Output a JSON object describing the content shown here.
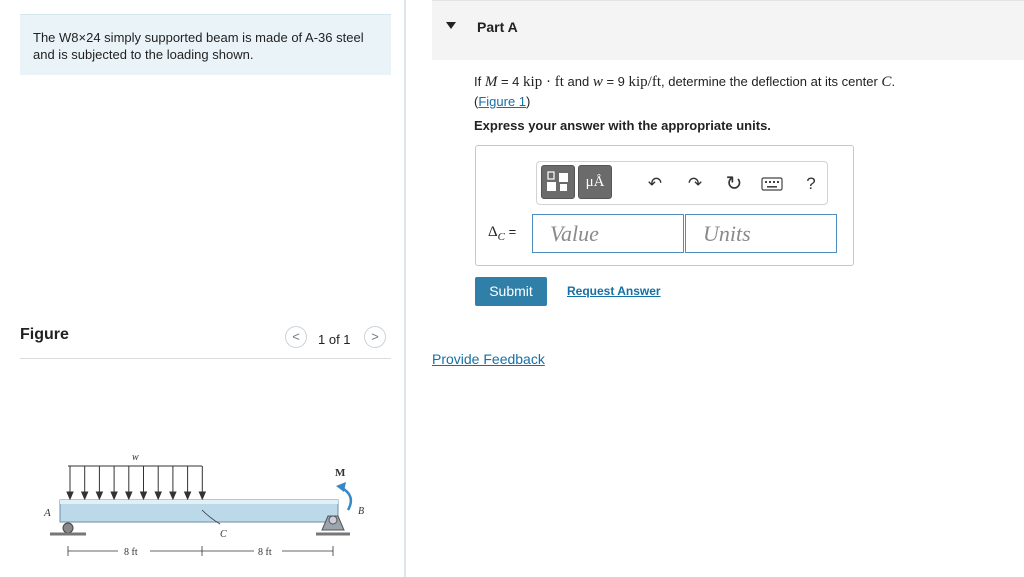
{
  "problem": {
    "text": "The W8×24 simply supported beam is made of A-36 steel and is subjected to the loading shown."
  },
  "figure_panel": {
    "title": "Figure",
    "pager": "1 of 1",
    "prev_glyph": "<",
    "next_glyph": ">",
    "labels": {
      "w": "w",
      "M": "M",
      "A": "A",
      "B": "B",
      "C": "C",
      "dim1": "8 ft",
      "dim2": "8 ft"
    }
  },
  "part": {
    "title": "Part A",
    "q_if": "If",
    "q_M": "M",
    "q_eq1": " = 4",
    "q_unit1": "kip · ft",
    "q_and": "and",
    "q_w": "w",
    "q_eq2": " = 9",
    "q_unit2": "kip/ft",
    "q_rest": ", determine the deflection at its center",
    "q_C": "C",
    "q_end": ".",
    "fig_link_open": "(",
    "fig_link": "Figure 1",
    "fig_link_close": ")",
    "express": "Express your answer with the appropriate units."
  },
  "answer": {
    "delta_label": "Δ",
    "delta_sub": "C",
    "delta_eq": " =",
    "value_placeholder": "Value",
    "units_placeholder": "Units",
    "toolbar": {
      "templates_label": "templates",
      "units_label": "μÅ",
      "undo_icon": "↶",
      "redo_icon": "↷",
      "reset_icon": "↻",
      "help_label": "?"
    }
  },
  "actions": {
    "submit": "Submit",
    "request_answer": "Request Answer",
    "provide_feedback": "Provide Feedback"
  },
  "colors": {
    "accent": "#2f7fa8",
    "link": "#1570a6",
    "beam": "#bcd9ea"
  }
}
